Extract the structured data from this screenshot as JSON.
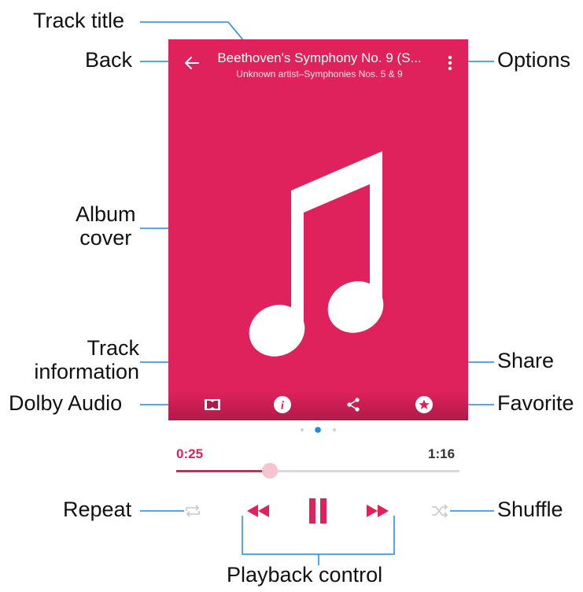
{
  "callouts": {
    "track_title": "Track title",
    "back": "Back",
    "options": "Options",
    "album_cover": "Album\ncover",
    "track_information": "Track\ninformation",
    "share": "Share",
    "dolby_audio": "Dolby Audio",
    "favorite": "Favorite",
    "repeat": "Repeat",
    "shuffle": "Shuffle",
    "playback_control": "Playback control"
  },
  "header": {
    "title": "Beethoven's Symphony No. 9 (S...",
    "subtitle": "Unknown artist–Symphonies Nos. 5 & 9"
  },
  "icons": {
    "back": "arrow-left-icon",
    "options": "more-vert-icon",
    "album_art": "music-note-icon",
    "dolby": "dolby-icon",
    "info": "info-icon",
    "share": "share-icon",
    "favorite": "star-icon",
    "repeat": "repeat-icon",
    "rewind": "rewind-icon",
    "pause": "pause-icon",
    "forward": "fast-forward-icon",
    "shuffle": "shuffle-icon"
  },
  "pager": {
    "count": 3,
    "active": 2
  },
  "progress": {
    "elapsed": "0:25",
    "duration": "1:16",
    "fraction": 0.33
  },
  "colors": {
    "accent": "#e0225c",
    "cover_bg": "#e0225c",
    "track": "#d9d9d9",
    "text_dark": "#333333",
    "inactive_icon": "#c8c8c8"
  }
}
